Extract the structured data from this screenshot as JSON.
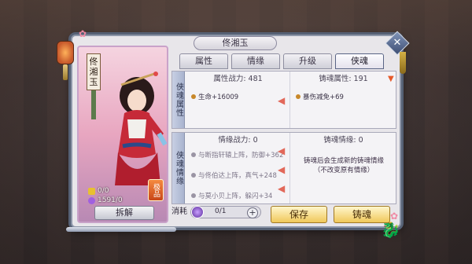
{
  "window": {
    "title": "佟湘玉",
    "close_icon": "close-icon"
  },
  "character": {
    "name": "佟湘玉",
    "quality_label": "极品",
    "stat1": "0/0",
    "stat2": "1591/0",
    "dismantle_label": "拆解"
  },
  "tabs": [
    {
      "label": "属性",
      "active": false
    },
    {
      "label": "情缘",
      "active": false
    },
    {
      "label": "升级",
      "active": false
    },
    {
      "label": "侠魂",
      "active": true
    }
  ],
  "xiahun_panel": {
    "side_label": "侠魂属性",
    "left_head": "属性战力: 481",
    "left_attr": "生命+16009",
    "right_head": "铸魂属性: 191",
    "right_attr": "暴伤减免+69"
  },
  "qingyuan_panel": {
    "side_label": "侠魂情缘",
    "left_head": "情缘战力: 0",
    "lines": [
      "与断指轩辕上阵，防御+362",
      "与佟伯达上阵，真气+248",
      "与莫小贝上阵，躲闪+34"
    ],
    "right_head": "铸魂情缘: 0",
    "notice": "铸魂后会生成新的铸魂情缘（不改变原有情缘）"
  },
  "footer": {
    "consume_label": "消耗",
    "consume_value": "0/1",
    "save_label": "保存",
    "forge_label": "铸魂"
  }
}
